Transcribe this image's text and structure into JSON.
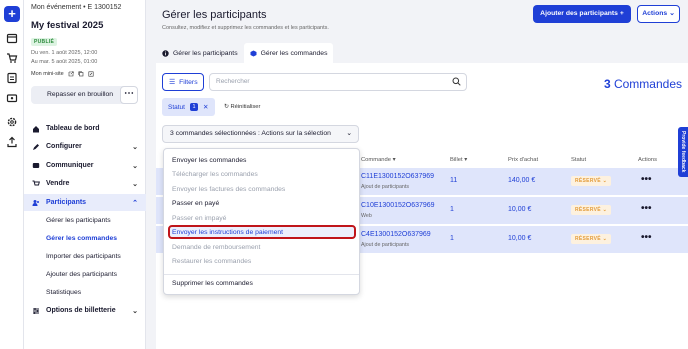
{
  "event": {
    "label": "Mon événement • E 1300152",
    "title": "My festival 2025",
    "status": "PUBLIÉ",
    "date_start": "Du ven. 1 août 2025, 12:00",
    "date_end": "Au mar. 5 août 2025, 01:00",
    "minisite": "Mon mini-site",
    "draft_button": "Repasser en brouillon"
  },
  "nav": {
    "dashboard": "Tableau de bord",
    "configure": "Configurer",
    "communicate": "Communiquer",
    "sell": "Vendre",
    "participants": "Participants",
    "sub": [
      "Gérer les participants",
      "Gérer les commandes",
      "Importer des participants",
      "Ajouter des participants",
      "Statistiques"
    ],
    "ticketing": "Options de billetterie"
  },
  "header": {
    "title": "Gérer les participants",
    "subtitle": "Consultez, modifiez et supprimez les commandes et les participants.",
    "add_button": "Ajouter des participants +",
    "actions_button": "Actions"
  },
  "tabs": [
    "Gérer les participants",
    "Gérer les commandes"
  ],
  "toolbar": {
    "filters": "Filters",
    "search_placeholder": "Rechercher",
    "count_number": "3",
    "count_label": "Commandes",
    "statut": "Statut",
    "statut_count": "1",
    "reset": "Réinitialiser",
    "bulk_actions": "3 commandes sélectionnées : Actions sur la sélection"
  },
  "table": {
    "headers": [
      "Commande",
      "Billet",
      "Prix d'achat",
      "Statut",
      "Actions"
    ],
    "rows": [
      {
        "order": "C11E1300152O637969",
        "source": "Ajout de participants",
        "tickets": "11",
        "price": "140,00 €",
        "status": "RÉSERVÉ"
      },
      {
        "order": "C10E1300152O637969",
        "source": "Web",
        "tickets": "1",
        "price": "10,00 €",
        "status": "RÉSERVÉ"
      },
      {
        "order": "C4E1300152O637969",
        "source": "Ajout de participants",
        "tickets": "1",
        "price": "10,00 €",
        "status": "RÉSERVÉ"
      }
    ]
  },
  "menu": {
    "items": [
      {
        "label": "Envoyer les commandes"
      },
      {
        "label": "Télécharger les commandes"
      },
      {
        "label": "Envoyer les factures des commandes"
      },
      {
        "label": "Passer en payé"
      },
      {
        "label": "Passer en impayé"
      },
      {
        "label": "Envoyer les instructions de paiement"
      },
      {
        "label": "Demande de remboursement"
      },
      {
        "label": "Restaurer les commandes"
      },
      {
        "label": "Supprimer les commandes"
      }
    ]
  },
  "feedback": "Provide feedback",
  "colors": {
    "accent": "#1f3fd6",
    "highlight": "#c0151a",
    "reserved": "#e39c3a"
  }
}
